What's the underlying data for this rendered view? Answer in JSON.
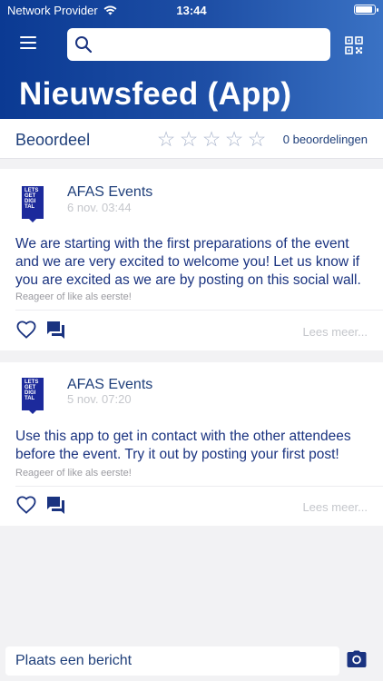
{
  "status_bar": {
    "carrier": "Network Provider",
    "time": "13:44",
    "wifi_icon": "wifi-icon",
    "battery_level": 0.9
  },
  "header": {
    "menu_icon": "hamburger-menu-icon",
    "search": {
      "placeholder": "",
      "value": ""
    },
    "qr_icon": "qr-code-icon",
    "title": "Nieuwsfeed (App)"
  },
  "rating": {
    "label": "Beoordeel",
    "stars_total": 5,
    "stars_filled": 0,
    "count_text": "0 beoordelingen"
  },
  "posts": [
    {
      "author": "AFAS Events",
      "date": "6 nov. 03:44",
      "avatar_text": "LETS GET DIGI TAL",
      "body": "We are starting with the first preparations of the event and we are very excited to welcome you! Let us know if you are excited as we are by posting on this social wall.",
      "reply_hint": "Reageer of like als eerste!",
      "more_label": "Lees meer..."
    },
    {
      "author": "AFAS Events",
      "date": "5 nov. 07:20",
      "avatar_text": "LETS GET DIGI TAL",
      "body": "Use this app to get in contact with the other attendees before the event. Try it out by posting your first post!",
      "reply_hint": "Reageer of like als eerste!",
      "more_label": "Lees meer..."
    }
  ],
  "composer": {
    "placeholder": "Plaats een bericht",
    "camera_icon": "camera-icon"
  },
  "colors": {
    "brand": "#0b3a93",
    "text": "#1a3380",
    "muted": "#c5c7cc",
    "background": "#f2f2f4"
  }
}
